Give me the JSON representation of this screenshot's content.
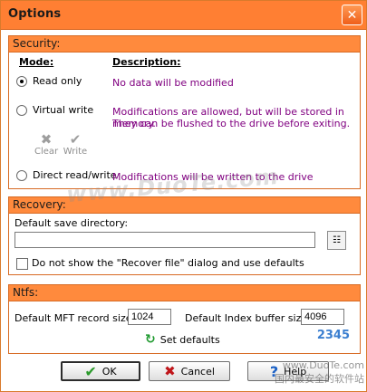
{
  "window": {
    "title": "Options",
    "close_glyph": "✕"
  },
  "security": {
    "title": "Security:",
    "mode_header": "Mode:",
    "description_header": "Description:",
    "read_only": {
      "label": "Read only",
      "description": "No data will be modified",
      "selected": true
    },
    "virtual_write": {
      "label": "Virtual write",
      "description_line1": "Modifications are allowed, but will be stored in memory.",
      "description_line2": "They can be flushed to the drive before exiting.",
      "selected": false
    },
    "clear_label": "Clear",
    "write_label": "Write",
    "direct_rw": {
      "label": "Direct read/write",
      "description": "Modifications will be written to the drive",
      "selected": false
    }
  },
  "recovery": {
    "title": "Recovery:",
    "default_dir_label": "Default save directory:",
    "default_dir_value": "",
    "checkbox_label": "Do not show the \"Recover file\" dialog and use defaults",
    "checkbox_checked": false
  },
  "ntfs": {
    "title": "Ntfs:",
    "mft_label": "Default MFT record size:",
    "mft_value": "1024",
    "index_label": "Default Index buffer size:",
    "index_value": "4096",
    "set_defaults_label": "Set defaults"
  },
  "buttons": {
    "ok": "OK",
    "cancel": "Cancel",
    "help": "Help"
  },
  "watermark": {
    "main": "www.DuoTe.com",
    "site": "www.DuoTe.com",
    "brand": "2345",
    "bottom": "国内最安全的软件站"
  },
  "colors": {
    "orange": "#ff7f33",
    "panel_orange": "#ff8a3d",
    "purple": "#800080"
  }
}
